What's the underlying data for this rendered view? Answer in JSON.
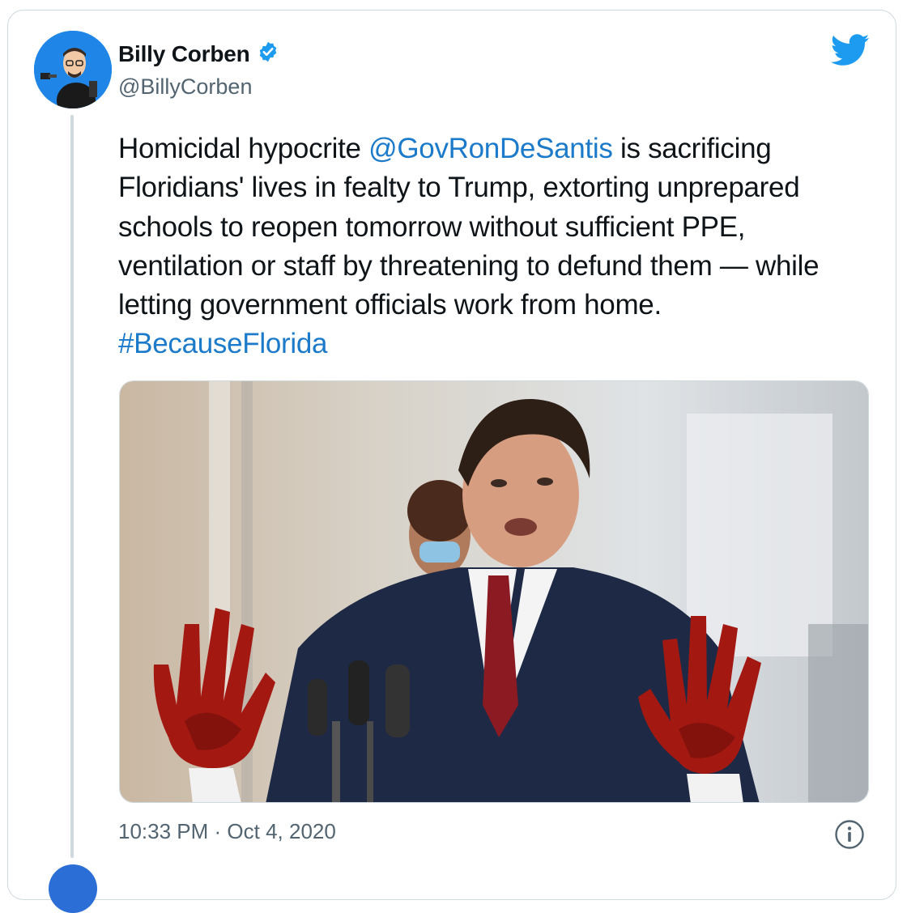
{
  "author": {
    "display_name": "Billy Corben",
    "handle": "@BillyCorben",
    "verified_icon": "verified-badge-icon",
    "avatar": "cartoon-avatar"
  },
  "tweet": {
    "text_1": "Homicidal hypocrite ",
    "mention": "@GovRonDeSantis",
    "text_2": " is sacrificing Floridians' lives in fealty to Trump, extorting unprepared schools to reopen tomorrow without sufficient PPE, ventilation or staff by threatening to defund them — while letting government officials work from home. ",
    "hashtag": "#BecauseFlorida"
  },
  "media": {
    "kind": "photo",
    "icon": "tweet-photo"
  },
  "meta": {
    "time": "10:33 PM",
    "separator": " · ",
    "date": "Oct 4, 2020"
  },
  "icons": {
    "brand": "twitter-bird-icon",
    "info": "info-icon"
  },
  "colors": {
    "link": "#1b7ac9",
    "twitter_blue": "#1d9bf0",
    "muted": "#536471",
    "border": "#cfd9de"
  }
}
